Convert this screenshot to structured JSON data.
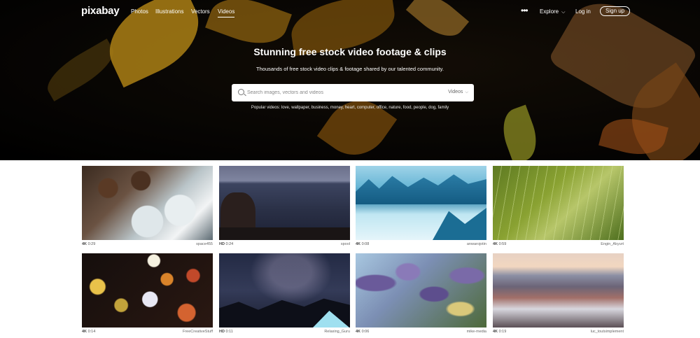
{
  "brand": {
    "logo": "pixabay"
  },
  "nav": {
    "links": [
      "Photos",
      "Illustrations",
      "Vectors",
      "Videos"
    ],
    "active": "Videos",
    "more_icon": "more-horizontal-icon",
    "explore_label": "Explore",
    "login_label": "Log in",
    "signup_label": "Sign up"
  },
  "hero": {
    "title": "Stunning free stock video footage & clips",
    "subtitle": "Thousands of free stock video clips & footage shared by our talented community.",
    "search": {
      "placeholder": "Search images, vectors and videos",
      "value": "",
      "type_selected": "Videos"
    },
    "popular": "Popular videos: love, wallpaper, business, money, heart, computer, office, nature, food, people, dog, family"
  },
  "videos": [
    {
      "quality": "4K",
      "duration": "0:29",
      "user": "space455"
    },
    {
      "quality": "HD",
      "duration": "0:24",
      "user": "spool"
    },
    {
      "quality": "4K",
      "duration": "0:08",
      "user": "anwarojotin"
    },
    {
      "quality": "4K",
      "duration": "0:59",
      "user": "Engin_Akyurt"
    },
    {
      "quality": "4K",
      "duration": "0:14",
      "user": "FreeCreativeStuff"
    },
    {
      "quality": "HD",
      "duration": "0:11",
      "user": "Relaxing_Guru"
    },
    {
      "quality": "4K",
      "duration": "0:06",
      "user": "mike-media"
    },
    {
      "quality": "4K",
      "duration": "0:19",
      "user": "luc_toutsimplement"
    }
  ]
}
